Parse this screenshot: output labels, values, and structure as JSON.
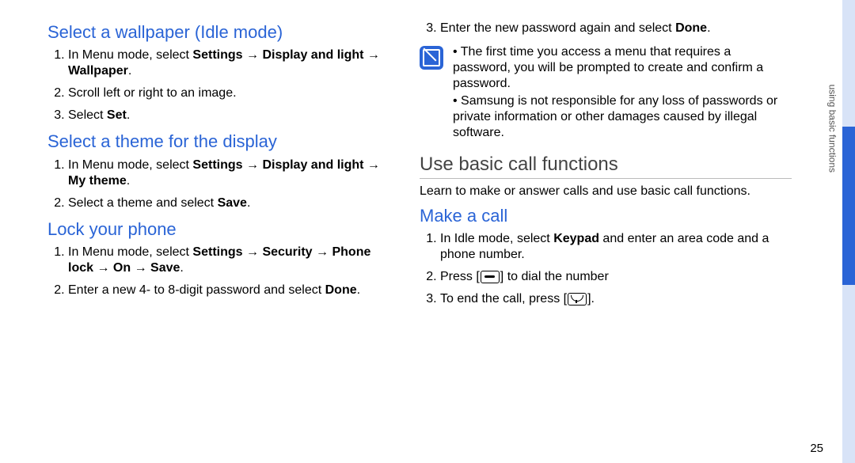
{
  "side_label": "using basic functions",
  "page_number": "25",
  "left": {
    "sec1": {
      "title": "Select a wallpaper (Idle mode)",
      "li1_a": "In Menu mode, select ",
      "li1_b": "Settings",
      "li1_c": " → ",
      "li1_d": "Display and light",
      "li1_e": " → ",
      "li1_f": "Wallpaper",
      "li1_g": ".",
      "li2": "Scroll left or right to an image.",
      "li3_a": "Select ",
      "li3_b": "Set",
      "li3_c": "."
    },
    "sec2": {
      "title": "Select a theme for the display",
      "li1_a": "In Menu mode, select ",
      "li1_b": "Settings",
      "li1_c": " → ",
      "li1_d": "Display and light",
      "li1_e": " → ",
      "li1_f": "My theme",
      "li1_g": ".",
      "li2_a": "Select a theme and select ",
      "li2_b": "Save",
      "li2_c": "."
    },
    "sec3": {
      "title": "Lock your phone",
      "li1_a": "In Menu mode, select ",
      "li1_b": "Settings",
      "li1_c": " → ",
      "li1_d": "Security",
      "li1_e": " → ",
      "li1_f": "Phone lock",
      "li1_g": " → ",
      "li1_h": "On",
      "li1_i": " → ",
      "li1_j": "Save",
      "li1_k": ".",
      "li2_a": "Enter a new 4- to 8-digit password and select ",
      "li2_b": "Done",
      "li2_c": "."
    }
  },
  "right": {
    "cont_li3_a": "Enter the new password again and select ",
    "cont_li3_b": "Done",
    "cont_li3_c": ".",
    "note1": "The first time you access a menu that requires a password, you will be prompted to create and confirm a password.",
    "note2": "Samsung is not responsible for any loss of passwords or private information or other damages caused by illegal software.",
    "sec4": {
      "title": "Use basic call functions",
      "intro": "Learn to make or answer calls and use basic call functions."
    },
    "sec5": {
      "title": "Make a call",
      "li1_a": "In Idle mode, select ",
      "li1_b": "Keypad",
      "li1_c": " and enter an area code and a phone number.",
      "li2_a": "Press [",
      "li2_b": "] to dial the number",
      "li3_a": "To end the call, press [",
      "li3_b": "]."
    }
  }
}
